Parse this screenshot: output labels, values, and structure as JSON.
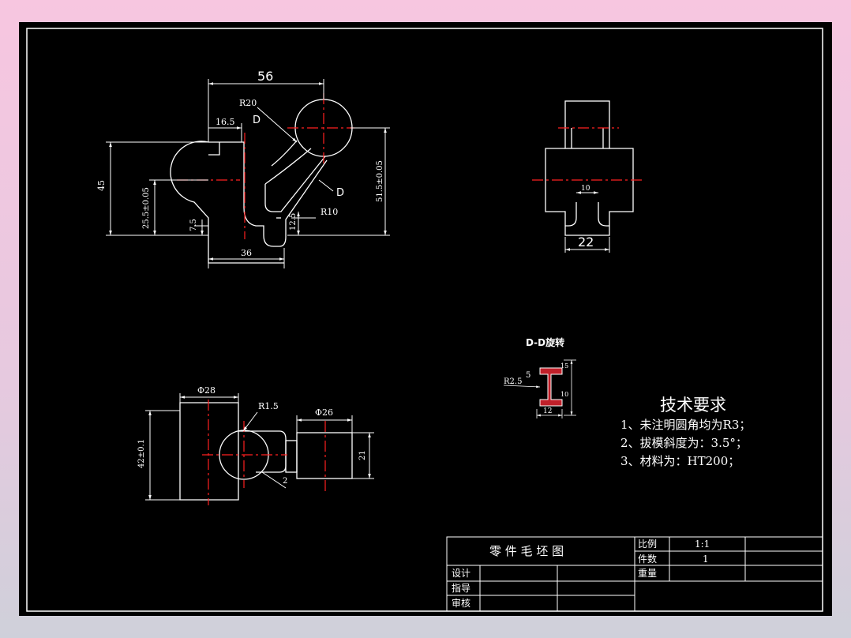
{
  "colors": {
    "background": "#000000",
    "line": "#ffffff",
    "centerline": "#ff2020",
    "outer": "#f7c6e0"
  },
  "front_view": {
    "dim_56": "56",
    "dim_16_5": "16.5",
    "dim_R20": "R20",
    "label_D1": "D",
    "label_D2": "D",
    "dim_45": "45",
    "dim_25_5": "25.5±0.05",
    "dim_7_5": "7.5",
    "dim_12_5": "12.5",
    "dim_R10": "R10",
    "dim_36": "36",
    "dim_51_5": "51.5±0.05"
  },
  "side_view": {
    "dim_10": "10",
    "dim_22": "22"
  },
  "top_view": {
    "dim_phi28": "Φ28",
    "dim_R1_5": "R1.5",
    "dim_phi26": "Φ26",
    "dim_42": "42±0.1",
    "dim_21": "21",
    "dim_2": "2"
  },
  "section_view": {
    "title": "D-D旋转",
    "dim_R2_5": "R2.5",
    "dim_5": "5",
    "dim_12": "12",
    "dim_top": "15",
    "dim_bottom": "10"
  },
  "tech_requirements": {
    "title": "技术要求",
    "items": [
      "1、未注明圆角均为R3；",
      "2、拔模斜度为：3.5°；",
      "3、材料为：HT200；"
    ]
  },
  "title_block": {
    "drawing_name": "零 件 毛 坯 图",
    "scale_label": "比例",
    "scale_value": "1:1",
    "count_label": "件数",
    "count_value": "1",
    "weight_label": "重量",
    "design_label": "设计",
    "check_label": "指导",
    "review_label": "审核"
  }
}
